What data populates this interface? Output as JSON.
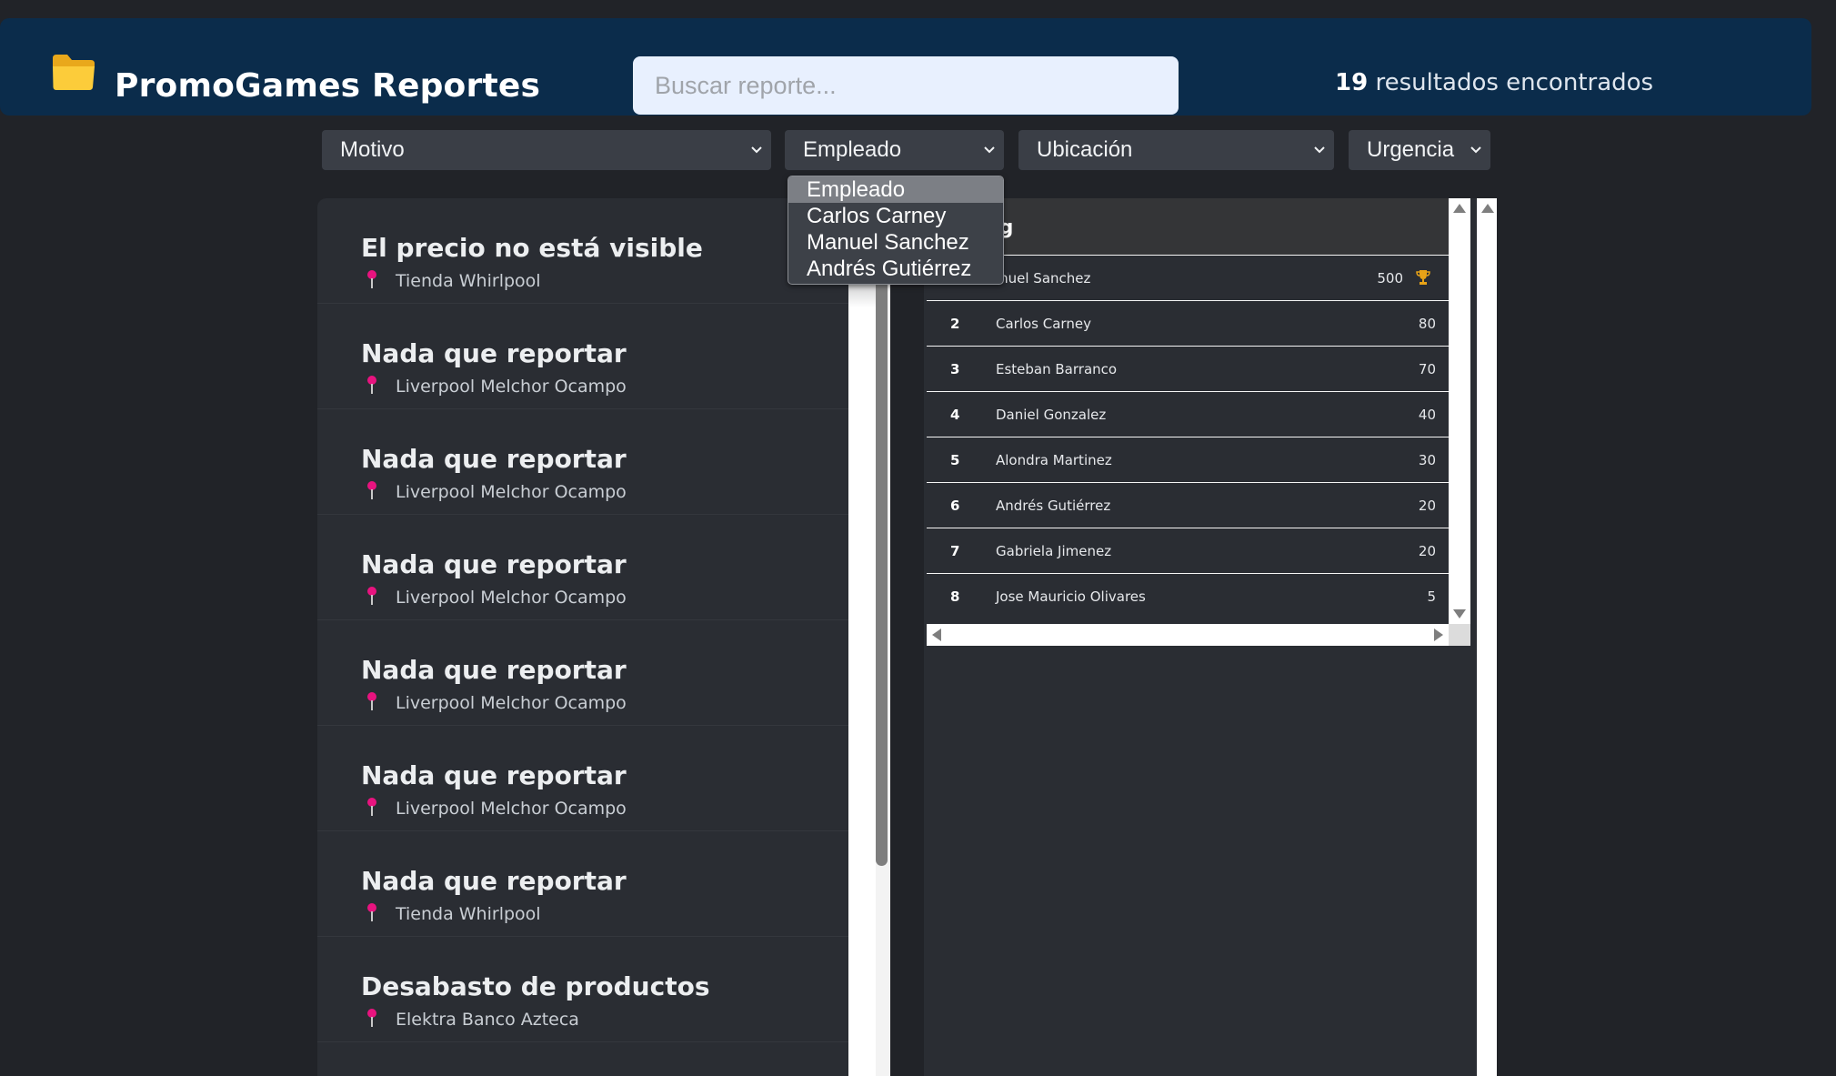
{
  "header": {
    "title": "PromoGames Reportes",
    "icon": "folder-icon",
    "search_placeholder": "Buscar reporte...",
    "results_count": "19",
    "results_label": "resultados encontrados"
  },
  "filters": {
    "motivo": "Motivo",
    "empleado": "Empleado",
    "ubicacion": "Ubicación",
    "urgencia": "Urgencia"
  },
  "empleado_dropdown": {
    "options": [
      "Empleado",
      "Carlos Carney",
      "Manuel Sanchez",
      "Andrés Gutiérrez"
    ],
    "selected": "Empleado"
  },
  "reports": [
    {
      "title": "El precio no está visible",
      "location": "Tienda Whirlpool"
    },
    {
      "title": "Nada que reportar",
      "location": "Liverpool Melchor Ocampo"
    },
    {
      "title": "Nada que reportar",
      "location": "Liverpool Melchor Ocampo"
    },
    {
      "title": "Nada que reportar",
      "location": "Liverpool Melchor Ocampo"
    },
    {
      "title": "Nada que reportar",
      "location": "Liverpool Melchor Ocampo"
    },
    {
      "title": "Nada que reportar",
      "location": "Liverpool Melchor Ocampo"
    },
    {
      "title": "Nada que reportar",
      "location": "Tienda Whirlpool"
    },
    {
      "title": "Desabasto de productos",
      "location": "Elektra Banco Azteca"
    }
  ],
  "ranking": {
    "header_visible": "ng",
    "rows": [
      {
        "pos": "",
        "name": "Manuel Sanchez",
        "points": "500",
        "trophy": true
      },
      {
        "pos": "2",
        "name": "Carlos Carney",
        "points": "80"
      },
      {
        "pos": "3",
        "name": "Esteban Barranco",
        "points": "70"
      },
      {
        "pos": "4",
        "name": "Daniel Gonzalez",
        "points": "40"
      },
      {
        "pos": "5",
        "name": "Alondra Martinez",
        "points": "30"
      },
      {
        "pos": "6",
        "name": "Andrés Gutiérrez",
        "points": "20"
      },
      {
        "pos": "7",
        "name": "Gabriela Jimenez",
        "points": "20"
      },
      {
        "pos": "8",
        "name": "Jose Mauricio Olivares",
        "points": "5"
      }
    ]
  },
  "colors": {
    "background": "#212328",
    "header": "#0b2c4b",
    "panel": "#2a2d33",
    "pin": "#e8137f",
    "trophy": "#e8a317"
  }
}
